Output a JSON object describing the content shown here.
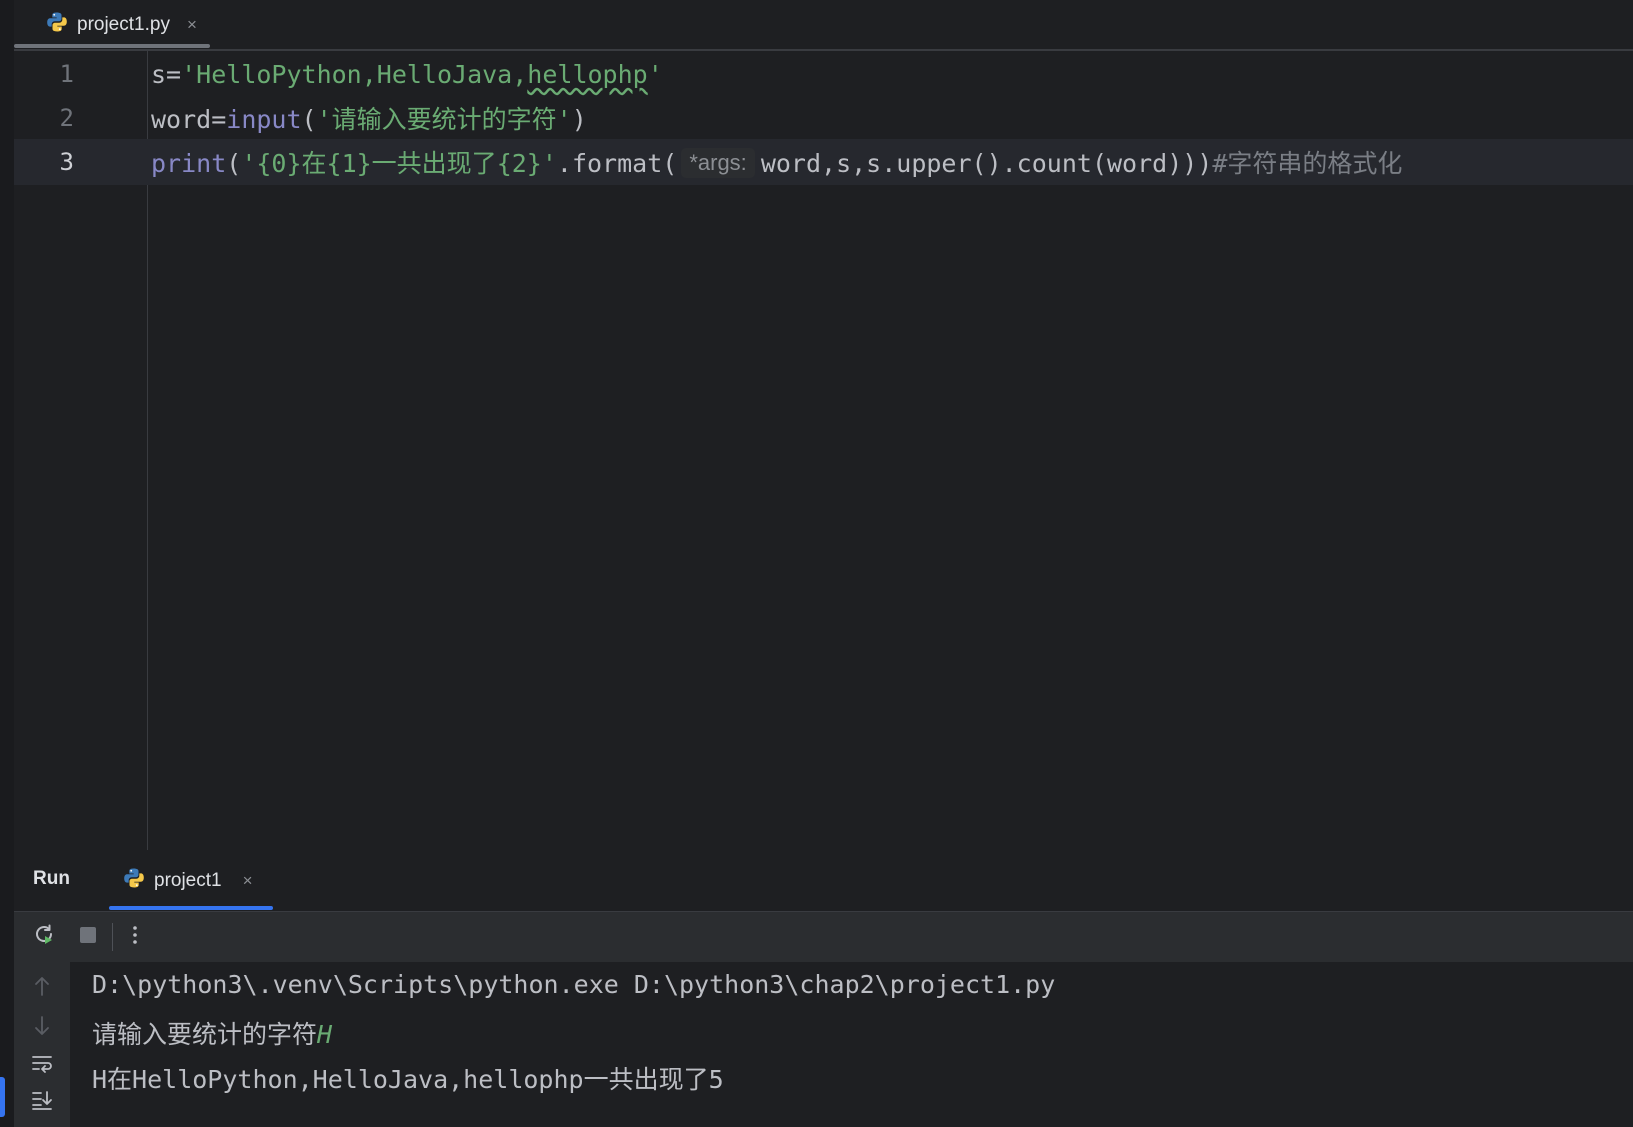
{
  "editor_tab": {
    "filename": "project1.py",
    "close": "×"
  },
  "code_lines": [
    {
      "num": "1",
      "parts": {
        "p1": "s=",
        "p2": "'HelloPython,HelloJava,",
        "p3": "hellophp",
        "p4": "'"
      }
    },
    {
      "num": "2",
      "parts": {
        "p1": "word=",
        "p2": "input",
        "p3": "(",
        "p4": "'请输入要统计的字符'",
        "p5": ")"
      }
    },
    {
      "num": "3",
      "parts": {
        "p1": "print",
        "p2": "(",
        "p3": "'{0}在{1}一共出现了{2}'",
        "p4": ".format(",
        "hint": "*args:",
        "p5": "word,s,s.upper().count(word)))",
        "p6": "#字符串的格式化"
      }
    }
  ],
  "run_panel": {
    "title": "Run",
    "tab_label": "project1",
    "close": "×",
    "toolbar": {
      "rerun_icon": "rerun-icon",
      "stop_icon": "stop-icon",
      "more_icon": "more-icon"
    },
    "side_tools": [
      "arrow-up-icon",
      "arrow-down-icon",
      "soft-wrap-icon",
      "scroll-to-end-icon"
    ],
    "output": {
      "line1": "D:\\python3\\.venv\\Scripts\\python.exe D:\\python3\\chap2\\project1.py",
      "line2_prompt": "请输入要统计的字符",
      "line2_input": "H",
      "line3": "H在HelloPython,HelloJava,hellophp一共出现了5"
    }
  },
  "colors": {
    "accent": "#3574f0",
    "string": "#6aab73",
    "builtin": "#8888c6",
    "comment": "#7a7e85"
  }
}
